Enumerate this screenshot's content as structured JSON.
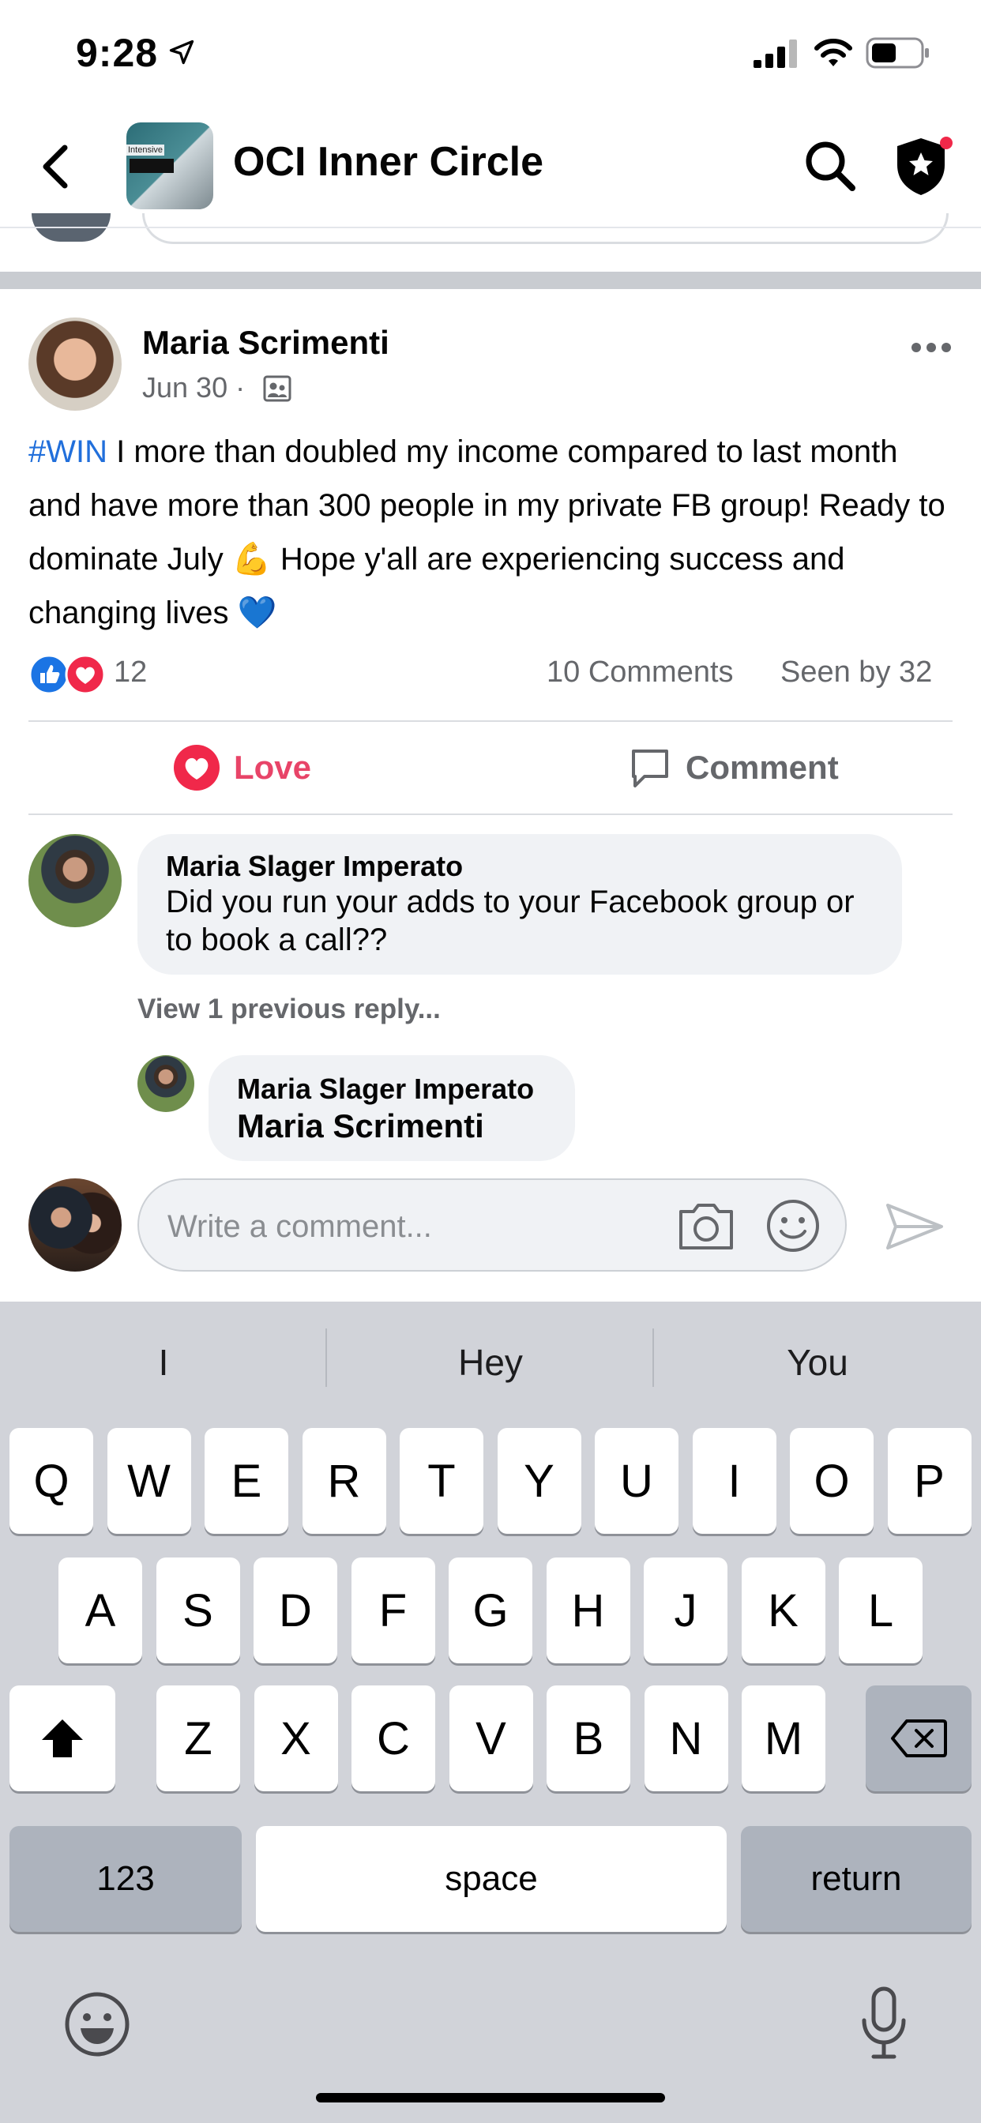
{
  "status_bar": {
    "time": "9:28"
  },
  "header": {
    "group_title": "OCI Inner Circle",
    "group_avatar_text": "Intensive"
  },
  "post": {
    "author": "Maria Scrimenti",
    "date": "Jun 30 ·",
    "text_tag": "#WIN",
    "text_body": " I more than doubled my income compared to last month and have more than 300 people in my private FB group! Ready to dominate July 💪 Hope y'all are experiencing success and changing lives 💙",
    "reaction_count": "12",
    "comments_count": "10 Comments",
    "seen_by": "Seen by 32",
    "love_label": "Love",
    "comment_label": "Comment"
  },
  "comments": [
    {
      "author": "Maria Slager Imperato",
      "text": "Did you run your adds to your Facebook group or to book a call??"
    }
  ],
  "view_previous": "View 1 previous reply...",
  "reply": {
    "author": "Maria Slager Imperato",
    "mention": "Maria Scrimenti"
  },
  "composer": {
    "placeholder": "Write a comment..."
  },
  "keyboard": {
    "suggestions": [
      "I",
      "Hey",
      "You"
    ],
    "row1": [
      "Q",
      "W",
      "E",
      "R",
      "T",
      "Y",
      "U",
      "I",
      "O",
      "P"
    ],
    "row2": [
      "A",
      "S",
      "D",
      "F",
      "G",
      "H",
      "J",
      "K",
      "L"
    ],
    "row3": [
      "Z",
      "X",
      "C",
      "V",
      "B",
      "N",
      "M"
    ],
    "numbers_label": "123",
    "space_label": "space",
    "return_label": "return"
  },
  "colors": {
    "link_blue": "#216fdb",
    "love_red": "#e84468",
    "keyboard_bg": "#d1d3d9"
  },
  "icons": [
    "location-arrow-icon",
    "signal-icon",
    "wifi-icon",
    "battery-icon",
    "back-chevron-icon",
    "search-icon",
    "admin-shield-icon",
    "audience-icon",
    "more-icon",
    "like-reaction-icon",
    "love-reaction-icon",
    "heart-icon",
    "comment-bubble-icon",
    "camera-icon",
    "emoji-icon",
    "send-icon",
    "shift-icon",
    "delete-icon",
    "keyboard-emoji-icon",
    "microphone-icon"
  ]
}
